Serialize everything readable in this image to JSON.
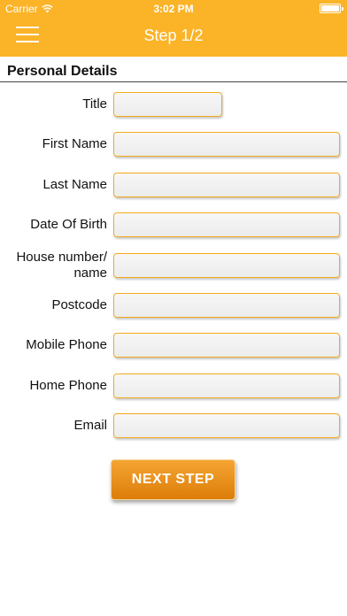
{
  "status_bar": {
    "carrier": "Carrier",
    "time": "3:02 PM"
  },
  "nav": {
    "title": "Step 1/2",
    "menu_icon": "hamburger-menu-icon"
  },
  "section": {
    "title": "Personal Details"
  },
  "form": {
    "fields": [
      {
        "label": "Title",
        "value": ""
      },
      {
        "label": "First Name",
        "value": ""
      },
      {
        "label": "Last Name",
        "value": ""
      },
      {
        "label": "Date Of Birth",
        "value": ""
      },
      {
        "label": "House number/ name",
        "value": ""
      },
      {
        "label": "Postcode",
        "value": ""
      },
      {
        "label": "Mobile Phone",
        "value": ""
      },
      {
        "label": "Home Phone",
        "value": ""
      },
      {
        "label": "Email",
        "value": ""
      }
    ],
    "next_button_label": "NEXT STEP"
  },
  "colors": {
    "accent": "#fbb327",
    "field_border": "#f3a91e",
    "button_top": "#f5a533",
    "button_bottom": "#dc7d08"
  }
}
